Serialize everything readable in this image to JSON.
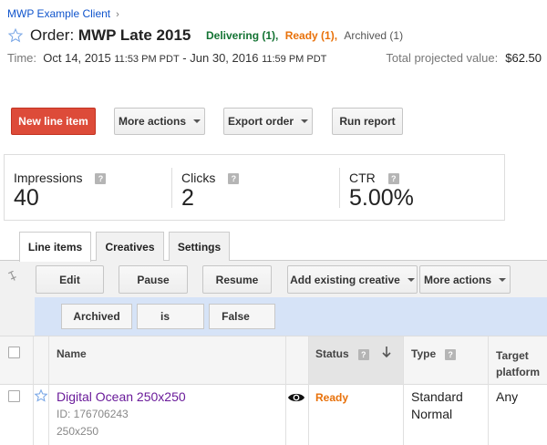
{
  "breadcrumb": {
    "client": "MWP Example Client",
    "chevron": "›"
  },
  "order": {
    "prefix": "Order:",
    "name": "MWP Late 2015",
    "status_delivering": "Delivering (1),",
    "status_ready": "Ready (1),",
    "status_archived": "Archived (1)",
    "time_label": "Time:",
    "start_date": "Oct 14, 2015",
    "start_time": "11:53 PM PDT",
    "separator": "-",
    "end_date": "Jun 30, 2016",
    "end_time": "11:59 PM PDT",
    "total_label": "Total projected value:",
    "total_value": "$62.50"
  },
  "actions": {
    "new_line_item": "New line item",
    "more_actions": "More actions",
    "export_order": "Export order",
    "run_report": "Run report"
  },
  "stats": {
    "impressions_label": "Impressions",
    "impressions_value": "40",
    "clicks_label": "Clicks",
    "clicks_value": "2",
    "ctr_label": "CTR",
    "ctr_value": "5.00%",
    "help_glyph": "?"
  },
  "tabs": [
    {
      "label": "Line items",
      "active": true
    },
    {
      "label": "Creatives",
      "active": false
    },
    {
      "label": "Settings",
      "active": false
    }
  ],
  "toolbar": {
    "edit": "Edit",
    "pause": "Pause",
    "resume": "Resume",
    "add_existing_creative": "Add existing creative",
    "more_actions": "More actions"
  },
  "filter": {
    "field": "Archived",
    "operator": "is",
    "value": "False"
  },
  "table": {
    "headers": {
      "name": "Name",
      "status": "Status",
      "type": "Type",
      "target_platform": "Target platform"
    },
    "rows": [
      {
        "name": "Digital Ocean 250x250",
        "id": "ID: 176706243",
        "size": "250x250",
        "status": "Ready",
        "type": "Standard",
        "priority": "Normal",
        "platform": "Any"
      }
    ]
  },
  "colors": {
    "primary_button": "#dd4b39",
    "link": "#1155cc",
    "delivering": "#137333",
    "ready": "#e8710a",
    "line_item_link": "#6a1b9a",
    "filter_bar": "#d6e3f7"
  }
}
